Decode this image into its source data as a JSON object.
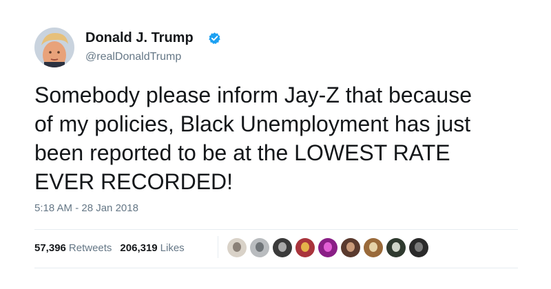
{
  "author": {
    "display_name": "Donald J. Trump",
    "handle": "@realDonaldTrump",
    "verified": true,
    "avatar_icon": "profile-photo",
    "verified_icon": "verified-badge-icon",
    "verified_color": "#1da1f2"
  },
  "tweet": {
    "text": "Somebody please inform Jay-Z that because\nof my policies, Black Unemployment has just\nbeen reported to be at the LOWEST RATE\nEVER RECORDED!",
    "timestamp": "5:18 AM - 28 Jan 2018"
  },
  "stats": {
    "retweets_count": "57,396",
    "retweets_label": "Retweets",
    "likes_count": "206,319",
    "likes_label": "Likes"
  },
  "liker_avatars": [
    {
      "name": "liker-avatar-1",
      "color": "#d9d2c8",
      "accent": "#8a8077"
    },
    {
      "name": "liker-avatar-2",
      "color": "#b9bcbf",
      "accent": "#6f7478"
    },
    {
      "name": "liker-avatar-3",
      "color": "#3a3a3a",
      "accent": "#a9a9a9"
    },
    {
      "name": "liker-avatar-4",
      "color": "#a9343c",
      "accent": "#e4b24a"
    },
    {
      "name": "liker-avatar-5",
      "color": "#8a1f86",
      "accent": "#e35fd6"
    },
    {
      "name": "liker-avatar-6",
      "color": "#5a3a2e",
      "accent": "#c99a7a"
    },
    {
      "name": "liker-avatar-7",
      "color": "#9a6a3a",
      "accent": "#e6d3a8"
    },
    {
      "name": "liker-avatar-8",
      "color": "#2f3a2f",
      "accent": "#cfd5c9"
    },
    {
      "name": "liker-avatar-9",
      "color": "#2a2a2a",
      "accent": "#7a7a7a"
    }
  ],
  "colors": {
    "text_primary": "#14171a",
    "text_secondary": "#657786",
    "divider": "#e6ecf0"
  }
}
